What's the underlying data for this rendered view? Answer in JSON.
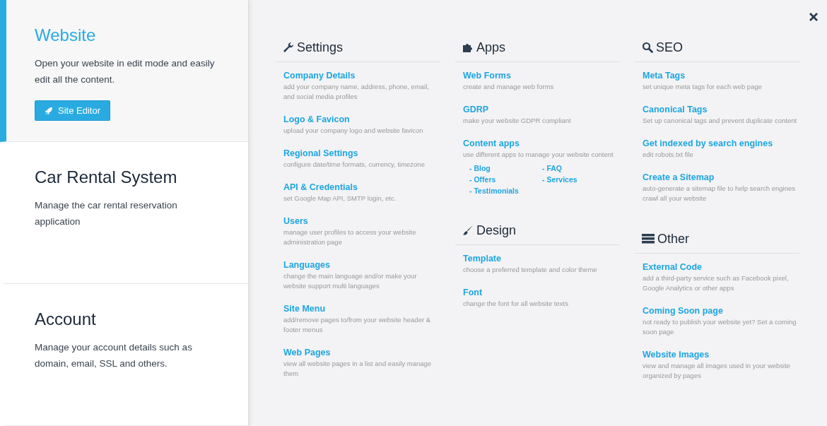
{
  "sidebar": {
    "items": [
      {
        "title": "Website",
        "description": "Open your website in edit mode and easily edit all the content.",
        "selected": true,
        "button": {
          "label": "Site Editor"
        }
      },
      {
        "title": "Car Rental System",
        "description": "Manage the car rental reservation application",
        "selected": false
      },
      {
        "title": "Account",
        "description": "Manage your account details such as domain, email, SSL and others.",
        "selected": false
      }
    ]
  },
  "columns": [
    {
      "sections": [
        {
          "title": "Settings",
          "kind": "wrench",
          "items": [
            {
              "title": "Company Details",
              "description": "add your company name, address, phone, email, and social media profiles"
            },
            {
              "title": "Logo & Favicon",
              "description": "upload your company logo and website favicon"
            },
            {
              "title": "Regional Settings",
              "description": "configure date/time formats, currency, timezone"
            },
            {
              "title": "API & Credentials",
              "description": "set Google Map API, SMTP login, etc."
            },
            {
              "title": "Users",
              "description": "manage user profiles to access your website administration page"
            },
            {
              "title": "Languages",
              "description": "change the main language and/or make your website support multi languages"
            },
            {
              "title": "Site Menu",
              "description": "add/remove pages to/from your website header & footer menus"
            },
            {
              "title": "Web Pages",
              "description": "view all website pages in a list and easily manage them"
            }
          ]
        }
      ]
    },
    {
      "sections": [
        {
          "title": "Apps",
          "kind": "puzzle",
          "items": [
            {
              "title": "Web Forms",
              "description": "create and manage web forms"
            },
            {
              "title": "GDRP",
              "description": "make your website GDPR compliant"
            },
            {
              "title": "Content apps",
              "description": "use different apps to manage your website content",
              "sublinks": [
                "- Blog",
                "- FAQ",
                "- Offers",
                "- Services",
                "- Testimonials"
              ]
            }
          ]
        },
        {
          "title": "Design",
          "kind": "brush",
          "items": [
            {
              "title": "Template",
              "description": "choose a preferred template and color theme"
            },
            {
              "title": "Font",
              "description": "change the font for all website texts"
            }
          ]
        }
      ]
    },
    {
      "sections": [
        {
          "title": "SEO",
          "kind": "search",
          "items": [
            {
              "title": "Meta Tags",
              "description": "set unique meta tags for each web page"
            },
            {
              "title": "Canonical Tags",
              "description": "Set up canonical tags and prevent duplicate content"
            },
            {
              "title": "Get indexed by search engines",
              "description": "edit robots.txt file"
            },
            {
              "title": "Create a Sitemap",
              "description": "auto-generate a sitemap file to help search engines crawl all your website"
            }
          ]
        },
        {
          "title": "Other",
          "kind": "server",
          "items": [
            {
              "title": "External Code",
              "description": "add a third-party service such as Facebook pixel, Google Analytics or other apps"
            },
            {
              "title": "Coming Soon page",
              "description": "not ready to publish your website yet? Set a coming soon page"
            },
            {
              "title": "Website Images",
              "description": "view and manage all images used in your website organized by pages"
            }
          ]
        }
      ]
    }
  ]
}
